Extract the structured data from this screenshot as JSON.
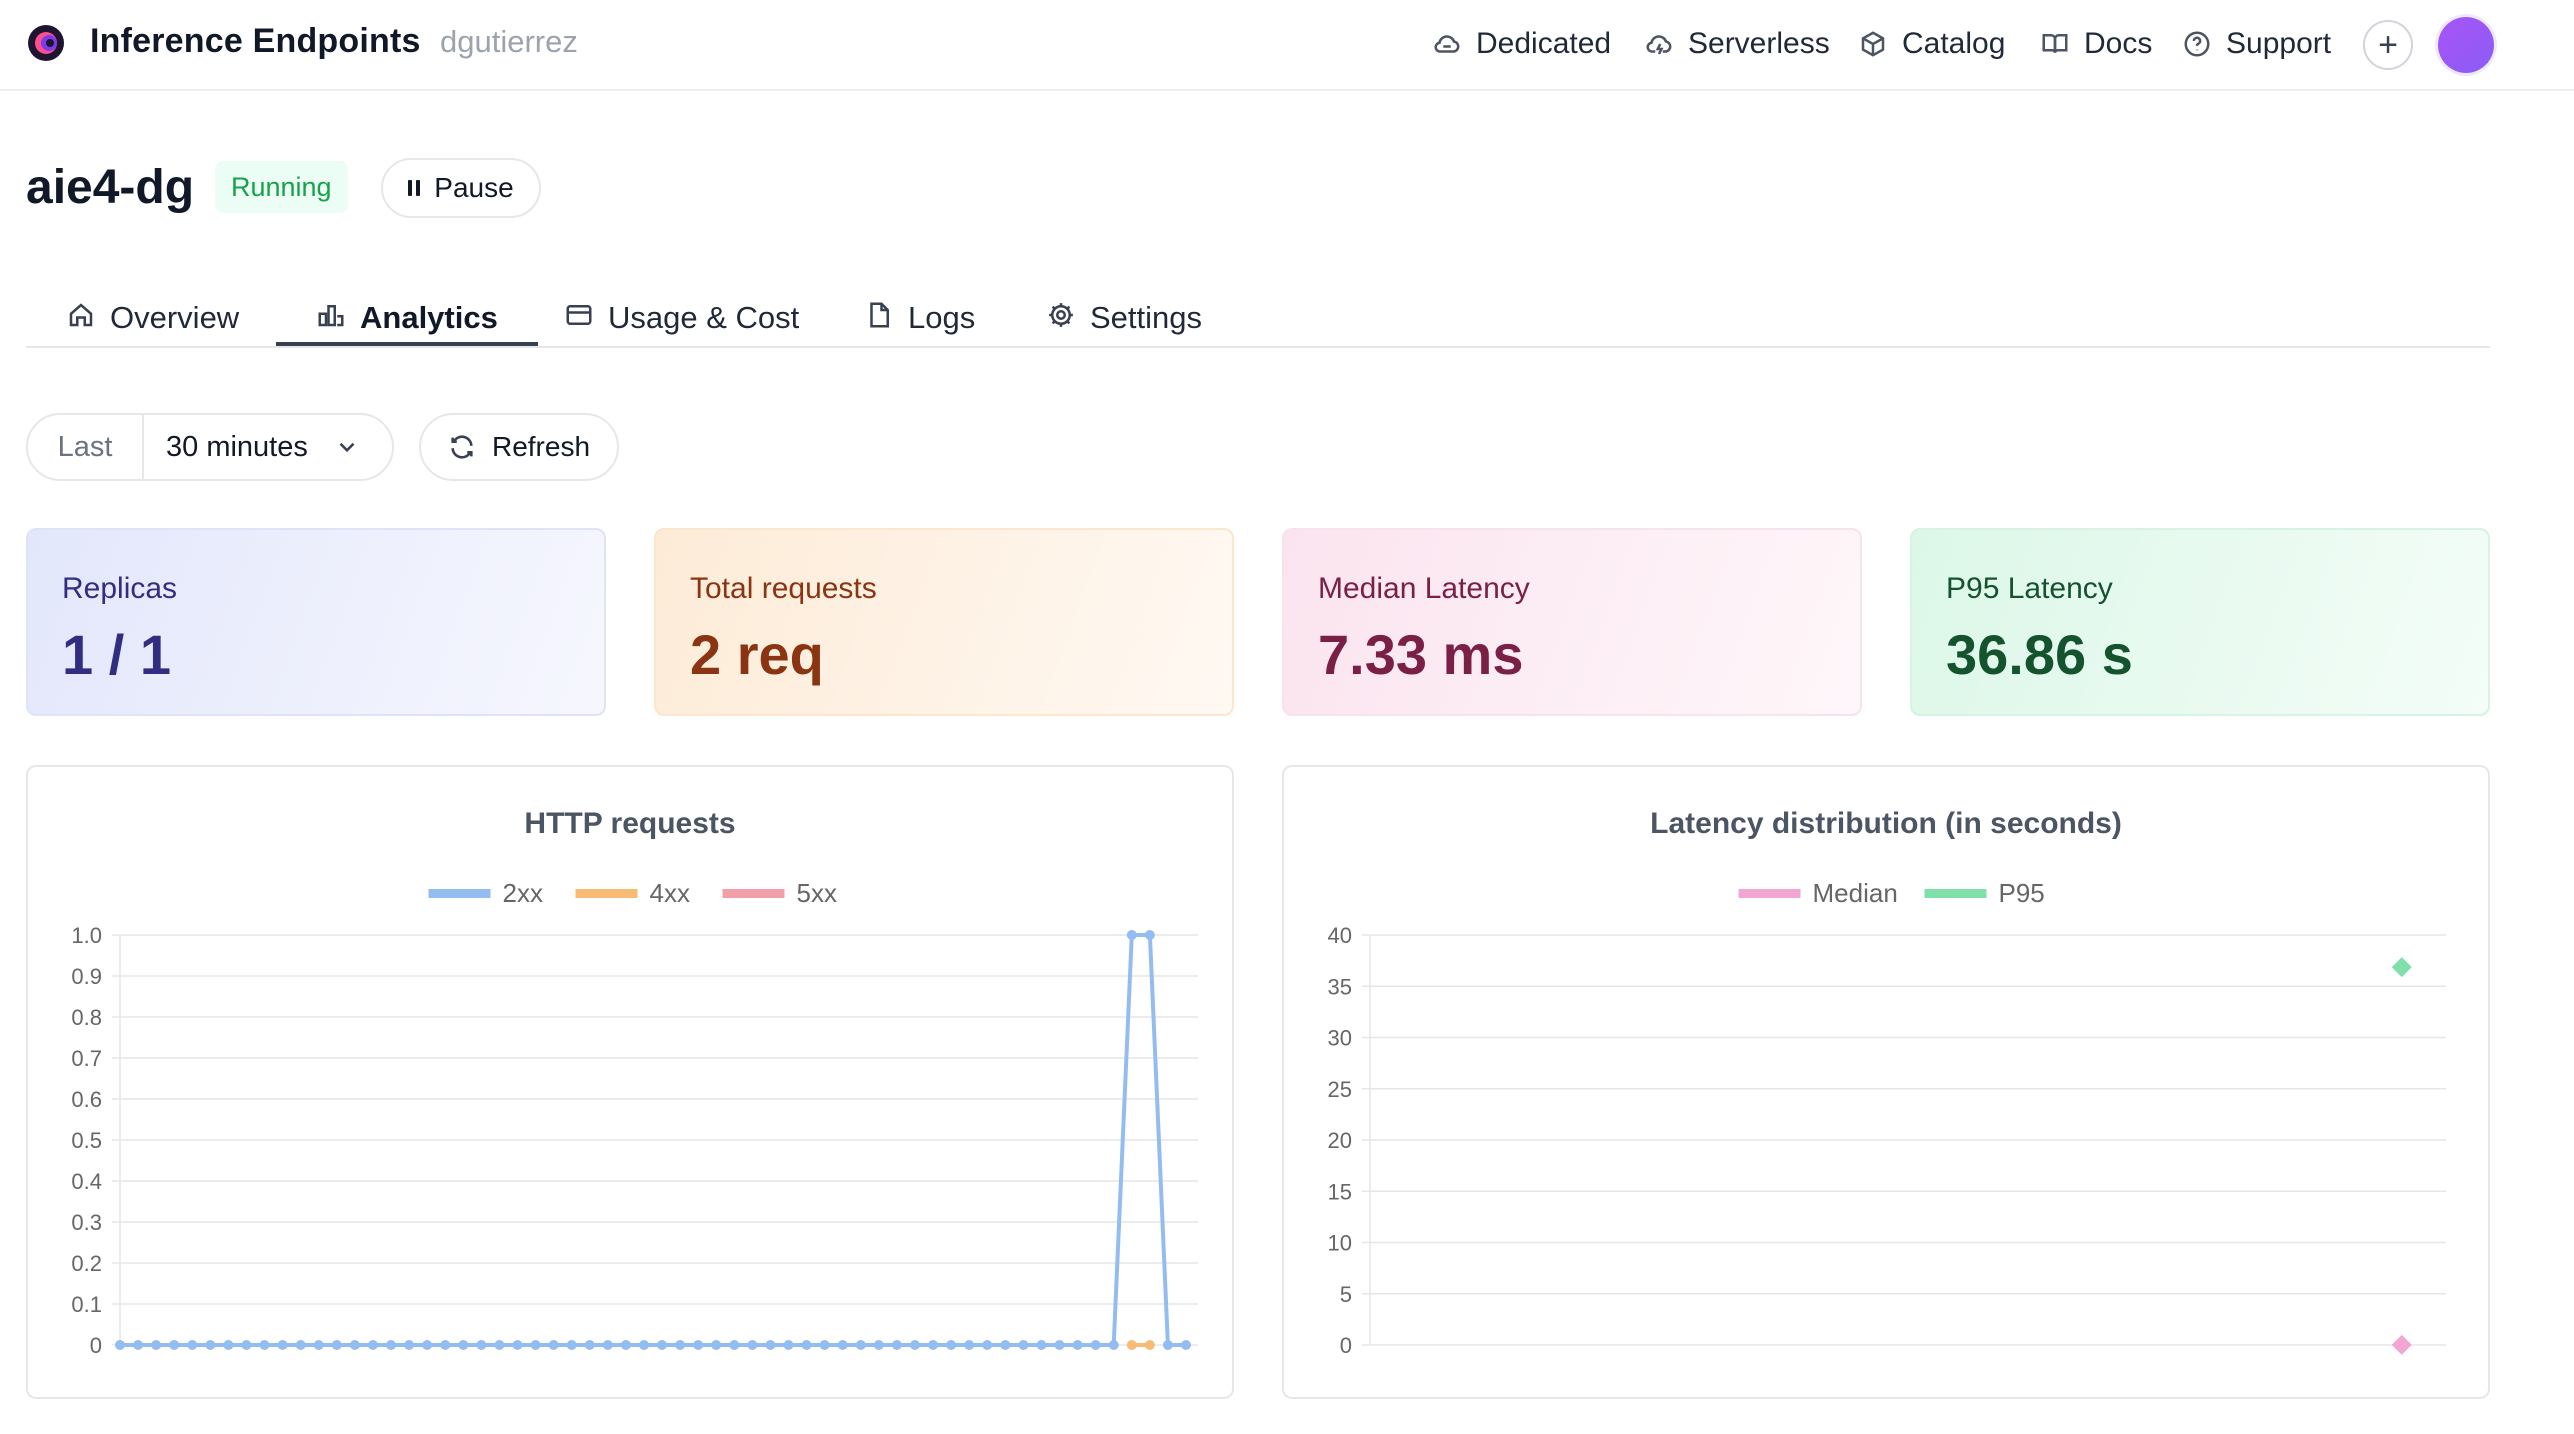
{
  "app": {
    "title": "Inference Endpoints",
    "username": "dgutierrez"
  },
  "nav": {
    "links": [
      {
        "label": "Dedicated",
        "icon": "cloud-link-icon"
      },
      {
        "label": "Serverless",
        "icon": "cloud-lightning-icon"
      },
      {
        "label": "Catalog",
        "icon": "cube-icon"
      },
      {
        "label": "Docs",
        "icon": "book-icon"
      },
      {
        "label": "Support",
        "icon": "help-circle-icon"
      }
    ],
    "plus_label": "+"
  },
  "endpoint": {
    "name": "aie4-dg",
    "status": "Running",
    "pause_label": "Pause"
  },
  "tabs": [
    {
      "label": "Overview",
      "icon": "home-icon",
      "active": false
    },
    {
      "label": "Analytics",
      "icon": "bar-chart-icon",
      "active": true
    },
    {
      "label": "Usage & Cost",
      "icon": "credit-card-icon",
      "active": false
    },
    {
      "label": "Logs",
      "icon": "file-icon",
      "active": false
    },
    {
      "label": "Settings",
      "icon": "gear-icon",
      "active": false
    }
  ],
  "controls": {
    "range_prefix": "Last",
    "range_value": "30 minutes",
    "refresh_label": "Refresh"
  },
  "stats": [
    {
      "label": "Replicas",
      "value": "1 / 1"
    },
    {
      "label": "Total requests",
      "value": "2 req"
    },
    {
      "label": "Median Latency",
      "value": "7.33 ms"
    },
    {
      "label": "P95 Latency",
      "value": "36.86 s"
    }
  ],
  "colors": {
    "s2xx": "#93bdf0",
    "s4xx": "#f7bb76",
    "s5xx": "#f0a0a6",
    "median": "#f2a6d3",
    "p95": "#7fe0aa",
    "grid": "#e6e6e6"
  },
  "chart_data": [
    {
      "type": "line",
      "title": "HTTP requests",
      "ylim": [
        0,
        1
      ],
      "yticks": [
        "0",
        "0.1",
        "0.2",
        "0.3",
        "0.4",
        "0.5",
        "0.6",
        "0.7",
        "0.8",
        "0.9",
        "1.0"
      ],
      "x_count": 60,
      "series": [
        {
          "name": "2xx",
          "values": [
            0,
            0,
            0,
            0,
            0,
            0,
            0,
            0,
            0,
            0,
            0,
            0,
            0,
            0,
            0,
            0,
            0,
            0,
            0,
            0,
            0,
            0,
            0,
            0,
            0,
            0,
            0,
            0,
            0,
            0,
            0,
            0,
            0,
            0,
            0,
            0,
            0,
            0,
            0,
            0,
            0,
            0,
            0,
            0,
            0,
            0,
            0,
            0,
            0,
            0,
            0,
            0,
            0,
            0,
            0,
            0,
            1,
            1,
            0,
            0
          ]
        },
        {
          "name": "4xx",
          "values": [
            null,
            null,
            null,
            null,
            null,
            null,
            null,
            null,
            null,
            null,
            null,
            null,
            null,
            null,
            null,
            null,
            null,
            null,
            null,
            null,
            null,
            null,
            null,
            null,
            null,
            null,
            null,
            null,
            null,
            null,
            null,
            null,
            null,
            null,
            null,
            null,
            null,
            null,
            null,
            null,
            null,
            null,
            null,
            null,
            null,
            null,
            null,
            null,
            null,
            null,
            null,
            null,
            null,
            null,
            null,
            null,
            0,
            0,
            null,
            null
          ]
        },
        {
          "name": "5xx",
          "values": []
        }
      ]
    },
    {
      "type": "scatter",
      "title": "Latency distribution (in seconds)",
      "ylim": [
        0,
        40
      ],
      "yticks": [
        "0",
        "5",
        "10",
        "15",
        "20",
        "25",
        "30",
        "35",
        "40"
      ],
      "x_count": 60,
      "series": [
        {
          "name": "Median",
          "points": [
            {
              "x": 57,
              "y": 0.00733
            }
          ]
        },
        {
          "name": "P95",
          "points": [
            {
              "x": 57,
              "y": 36.86
            }
          ]
        }
      ]
    }
  ]
}
